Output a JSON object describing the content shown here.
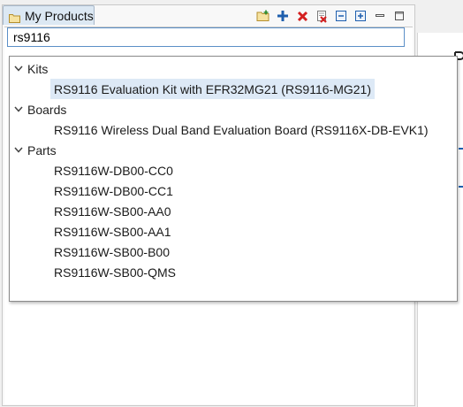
{
  "panel": {
    "tab_label": "My Products",
    "toolbar_icons": [
      "folder-add-icon",
      "add-icon",
      "delete-icon",
      "delete-all-icon",
      "collapse-all-icon",
      "expand-all-icon",
      "minimize-icon",
      "maximize-icon"
    ]
  },
  "search": {
    "value": "rs9116"
  },
  "dropdown": {
    "categories": [
      {
        "label": "Kits",
        "items": [
          "RS9116 Evaluation Kit with EFR32MG21 (RS9116-MG21)"
        ]
      },
      {
        "label": "Boards",
        "items": [
          "RS9116 Wireless Dual Band Evaluation Board (RS9116X-DB-EVK1)"
        ]
      },
      {
        "label": "Parts",
        "items": [
          "RS9116W-DB00-CC0",
          "RS9116W-DB00-CC1",
          "RS9116W-SB00-AA0",
          "RS9116W-SB00-AA1",
          "RS9116W-SB00-B00",
          "RS9116W-SB00-QMS"
        ]
      }
    ],
    "selected_item": "RS9116 Evaluation Kit with EFR32MG21 (RS9116-MG21)"
  },
  "colors": {
    "accent": "#1f5fae",
    "selection": "#dde9f6",
    "delete_red": "#d42020"
  }
}
